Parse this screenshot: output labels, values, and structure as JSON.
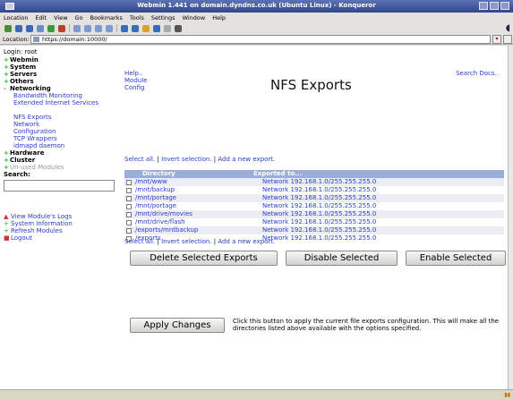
{
  "window": {
    "title": "Webmin 1.441 on domain.dyndns.co.uk (Ubuntu Linux) - Konqueror"
  },
  "menubar": [
    "Location",
    "Edit",
    "View",
    "Go",
    "Bookmarks",
    "Tools",
    "Settings",
    "Window",
    "Help"
  ],
  "location": {
    "label": "Location:",
    "url": "https://domain:10000/"
  },
  "sidebar": {
    "heading": "Login: root",
    "categories": [
      {
        "marker": "+",
        "label": "Webmin"
      },
      {
        "marker": "+",
        "label": "System"
      },
      {
        "marker": "+",
        "label": "Servers"
      },
      {
        "marker": "+",
        "label": "Others"
      },
      {
        "marker": "-",
        "label": "Networking"
      }
    ],
    "networking_items": [
      "Bandwidth Monitoring",
      "Extended Internet Services",
      "NFS Exports",
      "Network Configuration",
      "TCP Wrappers",
      "idmapd daemon"
    ],
    "categories_after": [
      {
        "marker": "+",
        "label": "Hardware"
      },
      {
        "marker": "+",
        "label": "Cluster"
      },
      {
        "marker": "+",
        "label": "Un-used Modules"
      }
    ],
    "search_label": "Search:",
    "search_value": "",
    "links": [
      {
        "marker": "▲",
        "label": "View Module's Logs"
      },
      {
        "marker": "+",
        "label": "System Information"
      },
      {
        "marker": "+",
        "label": "Refresh Modules"
      },
      {
        "marker": "■",
        "label": "Logout"
      }
    ]
  },
  "main": {
    "top_links": [
      "Help..",
      "Module Config"
    ],
    "title": "NFS Exports",
    "search_docs": "Search Docs..",
    "select_links": {
      "select_all": "Select all.",
      "invert": "Invert selection.",
      "add": "Add a new export."
    },
    "table": {
      "headers": [
        "Directory",
        "Exported to..."
      ],
      "rows": [
        {
          "directory": "/mnt/www",
          "exported_to": "Network 192.168.1.0/255.255.255.0"
        },
        {
          "directory": "/mnt/backup",
          "exported_to": "Network 192.168.1.0/255.255.255.0"
        },
        {
          "directory": "/mnt/portage",
          "exported_to": "Network 192.168.1.0/255.255.255.0"
        },
        {
          "directory": "/mnt/portage",
          "exported_to": "Network 192.168.1.0/255.255.255.0"
        },
        {
          "directory": "/mnt/drive/movies",
          "exported_to": "Network 192.168.1.0/255.255.255.0"
        },
        {
          "directory": "/mnt/drive/flash",
          "exported_to": "Network 192.168.1.0/255.255.255.0"
        },
        {
          "directory": "/exports/mntbackup",
          "exported_to": "Network 192.168.1.0/255.255.255.0"
        },
        {
          "directory": "/exports",
          "exported_to": "Network 192.168.1.0/255.255.255.0"
        }
      ]
    },
    "buttons": {
      "delete": "Delete Selected Exports",
      "disable": "Disable Selected",
      "enable": "Enable Selected",
      "apply": "Apply Changes"
    },
    "apply_description": "Click this button to apply the current file exports configuration. This will make all the directories listed above available with the options specified."
  },
  "colors": {
    "link": "#2a3dcc",
    "table_header": "#9aaedc",
    "titlebar": "#3a4f96"
  }
}
